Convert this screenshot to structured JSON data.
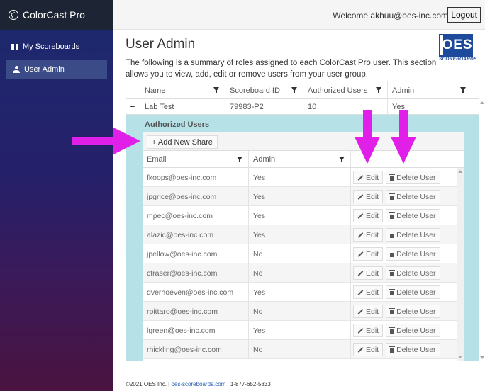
{
  "app": {
    "name": "ColorCast Pro"
  },
  "sidebar": {
    "items": [
      {
        "label": "My Scoreboards",
        "icon": "grid-icon"
      },
      {
        "label": "User Admin",
        "icon": "user-icon",
        "active": true
      }
    ]
  },
  "header": {
    "welcome": "Welcome akhuu@oes-inc.com",
    "logout_label": "Logout"
  },
  "page": {
    "title": "User Admin",
    "description": "The following is a summary of roles assigned to each ColorCast Pro user. This section allows you to view, add, edit or remove users from your user group.",
    "logo_text": "OES",
    "logo_sub": "SCOREBOARDS"
  },
  "grid": {
    "columns": [
      "Name",
      "Scoreboard ID",
      "Authorized Users",
      "Admin"
    ],
    "row": {
      "toggle": "−",
      "name": "Lab Test",
      "scoreboard_id": "79983-P2",
      "authorized_users": "10",
      "admin": "Yes"
    }
  },
  "detail": {
    "title": "Authorized Users",
    "add_label": "+ Add New Share",
    "columns": [
      "Email",
      "Admin"
    ],
    "edit_label": "Edit",
    "delete_label": "Delete User",
    "rows": [
      {
        "email": "fkoops@oes-inc.com",
        "admin": "Yes"
      },
      {
        "email": "jpgrice@oes-inc.com",
        "admin": "Yes"
      },
      {
        "email": "mpec@oes-inc.com",
        "admin": "Yes"
      },
      {
        "email": "alazic@oes-inc.com",
        "admin": "Yes"
      },
      {
        "email": "jpellow@oes-inc.com",
        "admin": "No"
      },
      {
        "email": "cfraser@oes-inc.com",
        "admin": "No"
      },
      {
        "email": "dverhoeven@oes-inc.com",
        "admin": "Yes"
      },
      {
        "email": "rpittaro@oes-inc.com",
        "admin": "No"
      },
      {
        "email": "lgreen@oes-inc.com",
        "admin": "Yes"
      },
      {
        "email": "rhickling@oes-inc.com",
        "admin": "No"
      }
    ]
  },
  "footer": {
    "copyright": "©2021 OES Inc. | ",
    "link": "oes-scoreboards.com",
    "phone": " | 1-877-652-5833"
  },
  "colors": {
    "annotation_arrow": "#e020e8",
    "detail_bg": "#b6e1e7",
    "sidebar_top": "#1c2a6e",
    "sidebar_bottom": "#4a1340"
  }
}
